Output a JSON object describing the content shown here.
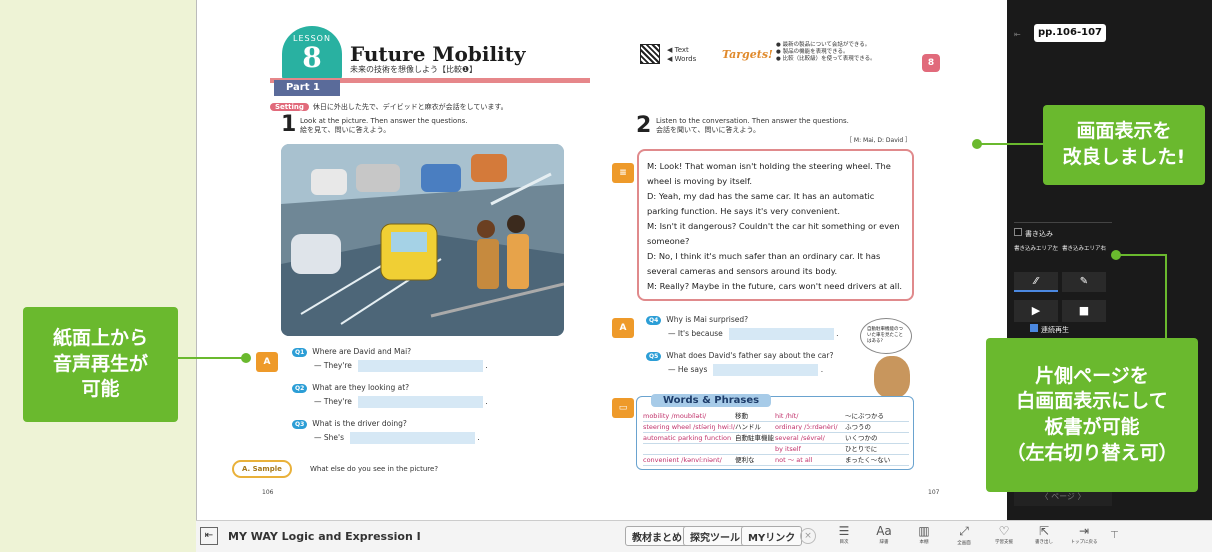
{
  "lesson": {
    "label": "LESSON",
    "number": "8",
    "title": "Future Mobility",
    "subtitle": "未来の技術を想像しよう【比較❶】"
  },
  "header": {
    "text": "Text",
    "words": "Words",
    "targets": "Targets!",
    "target_items": [
      "最新の製品について会話ができる。",
      "製品の機能を表現できる。",
      "比較（比較級）を使って表現できる。"
    ],
    "tab_number": "8"
  },
  "part": "Part 1",
  "setting": {
    "label": "Setting",
    "text": "休日に外出した先で、デイビッドと麻衣が会話をしています。"
  },
  "q1": {
    "num": "1",
    "en": "Look at the picture.  Then answer the questions.",
    "ja": "絵を見て、問いに答えよう。"
  },
  "q2": {
    "num": "2",
    "en": "Listen to the conversation.  Then answer the questions.",
    "ja": "会話を聞いて、問いに答えよう。",
    "speakers": "［ M: Mai, D: David ］"
  },
  "conversation": [
    {
      "sp": "M:",
      "t": "Look!  That woman isn't holding the steering wheel.  The wheel is moving by itself."
    },
    {
      "sp": "D:",
      "t": "Yeah, my dad has the same car.  It has an automatic parking function.  He says it's very convenient."
    },
    {
      "sp": "M:",
      "t": "Isn't it dangerous?  Couldn't the car hit something or even someone?"
    },
    {
      "sp": "D:",
      "t": "No, I think it's much safer than an ordinary car.  It has several cameras and sensors around its body."
    },
    {
      "sp": "M:",
      "t": "Really?  Maybe in the future, cars won't need drivers at all."
    }
  ],
  "left_questions": [
    {
      "q": "Q1",
      "text": "Where are David and Mai?",
      "ans": "— They're"
    },
    {
      "q": "Q2",
      "text": "What are they looking at?",
      "ans": "— They're"
    },
    {
      "q": "Q3",
      "text": "What is the driver doing?",
      "ans": "— She's"
    }
  ],
  "right_questions": [
    {
      "q": "Q4",
      "text": "Why is Mai surprised?",
      "ans": "— It's because"
    },
    {
      "q": "Q5",
      "text": "What does David's father say about the car?",
      "ans": "— He says"
    }
  ],
  "bubble": "自動駐車機能のついた車を見たことはある?",
  "sample": {
    "label": "A. Sample",
    "text": "What else do you see in the picture?"
  },
  "words": {
    "title": "Words & Phrases",
    "rows": [
      [
        "mobility /moubíləti/",
        "移動",
        "hit /hít/",
        "～にぶつかる"
      ],
      [
        "steering wheel /stíəriŋ hwi:l/",
        "ハンドル",
        "ordinary /ɔ́:rdənèri/",
        "ふつうの"
      ],
      [
        "automatic parking function",
        "自動駐車機能",
        "several /sévrəl/",
        "いくつかの"
      ],
      [
        "",
        "",
        "by itself",
        "ひとりでに"
      ],
      [
        "convenient /kənví:niənt/",
        "便利な",
        "not ～ at all",
        "まったく～ない"
      ]
    ]
  },
  "page_numbers": {
    "left": "106",
    "right": "107"
  },
  "panel": {
    "pages": "pp.106-107",
    "write": "書き込み",
    "area_left": "書き込みエリア左",
    "area_right": "書き込みエリア右",
    "continuous": "連続再生",
    "nav": "ページ"
  },
  "callouts": {
    "left": "紙面上から\n音声再生が\n可能",
    "top_right": "画面表示を\n改良しました!",
    "bottom_right": "片側ページを\n白画面表示にして\n板書が可能\n（左右切り替え可）"
  },
  "bottom": {
    "app_title": "MY WAY Logic and Expression I",
    "btn1": "教材まとめ",
    "btn2": "探究ツール",
    "btn3": "MYリンク",
    "tools": [
      "目次",
      "辞書",
      "本棚",
      "全画面",
      "学習支援",
      "書き出し",
      "トップに戻る"
    ]
  },
  "colors": {
    "accent": "#6ab92e",
    "teal": "#29b1a1",
    "pink": "#e08a8c"
  }
}
